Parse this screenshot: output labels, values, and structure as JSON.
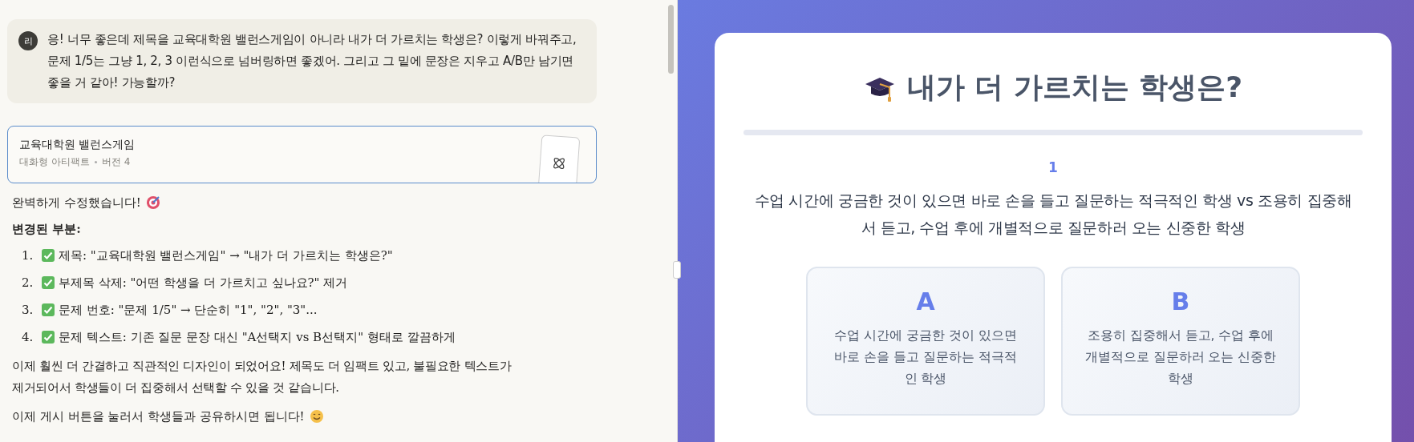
{
  "chat": {
    "user_message": {
      "avatar": "리",
      "text": "응! 너무 좋은데 제목을 교육대학원 밸런스게임이 아니라 내가 더 가르치는 학생은? 이렇게 바꿔주고, 문제 1/5는 그냥 1, 2, 3 이런식으로 넘버링하면 좋겠어. 그리고 그 밑에 문장은 지우고 A/B만 남기면 좋을 거 같아! 가능할까?"
    },
    "artifact": {
      "title": "교육대학원 밸런스게임",
      "type": "대화형 아티팩트",
      "version": "버전 4"
    },
    "reply": {
      "intro": "완벽하게 수정했습니다!",
      "heading": "변경된 부분:",
      "changes": [
        {
          "number": "1.",
          "text": "제목: \"교육대학원 밸런스게임\" → \"내가 더 가르치는 학생은?\""
        },
        {
          "number": "2.",
          "text": "부제목 삭제: \"어떤 학생을 더 가르치고 싶나요?\" 제거"
        },
        {
          "number": "3.",
          "text": "문제 번호: \"문제 1/5\" → 단순히 \"1\", \"2\", \"3\"..."
        },
        {
          "number": "4.",
          "text": "문제 텍스트: 기존 질문 문장 대신 \"A선택지 vs B선택지\" 형태로 깔끔하게"
        }
      ],
      "summary": "이제 훨씬 더 간결하고 직관적인 디자인이 되었어요! 제목도 더 임팩트 있고, 불필요한 텍스트가 제거되어서 학생들이 더 집중해서 선택할 수 있을 것 같습니다.",
      "closing": "이제 게시 버튼을 눌러서 학생들과 공유하시면 됩니다!"
    }
  },
  "preview": {
    "title": "내가 더 가르치는 학생은?",
    "question_number": "1",
    "question": "수업 시간에 궁금한 것이 있으면 바로 손을 들고 질문하는 적극적인 학생 vs 조용히 집중해서 듣고, 수업 후에 개별적으로 질문하러 오는 신중한 학생",
    "options": [
      {
        "letter": "A",
        "text": "수업 시간에 궁금한 것이 있으면 바로 손을 들고 질문하는 적극적인 학생"
      },
      {
        "letter": "B",
        "text": "조용히 집중해서 듣고, 수업 후에 개별적으로 질문하러 오는 신중한 학생"
      }
    ]
  }
}
